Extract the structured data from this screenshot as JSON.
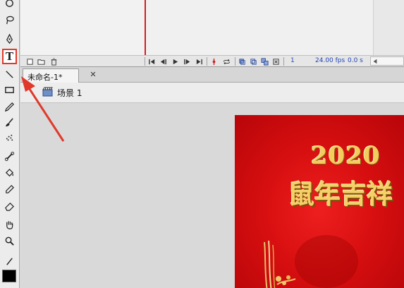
{
  "toolbar": {
    "text_tool_glyph": "T",
    "tools": [
      "lasso-tool",
      "pen-tool",
      "text-tool",
      "line-tool",
      "rectangle-tool",
      "pencil-tool",
      "brush-tool",
      "spray-brush-tool",
      "bone-tool",
      "paint-bucket-tool",
      "eyedropper-tool",
      "eraser-tool",
      "hand-tool",
      "zoom-tool",
      "stroke-color-tool"
    ]
  },
  "timeline": {
    "current_frame": "1",
    "fps": "24.00 fps",
    "seconds": "0.0 s"
  },
  "document": {
    "tab_title": "未命名-1*",
    "close_glyph": "✕",
    "scene": "场景 1"
  },
  "canvas": {
    "year_text": "2020",
    "greeting_text": "鼠年吉祥",
    "background": "#d80f10",
    "gold": "#f2cc5c"
  },
  "annotation": {
    "color": "#e0392b"
  }
}
